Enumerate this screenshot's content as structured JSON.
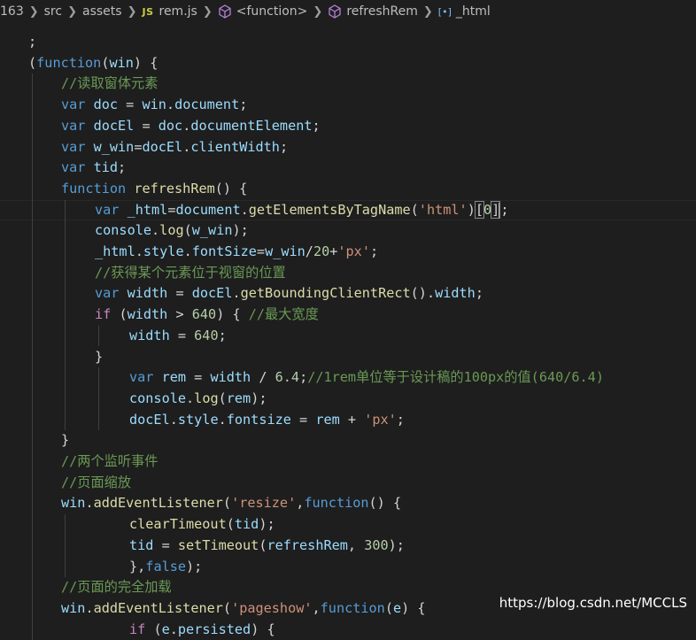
{
  "breadcrumb": {
    "line_ref": "163",
    "items": [
      "src",
      "assets",
      "rem.js",
      "<function>",
      "refreshRem",
      "_html"
    ],
    "js_badge": "JS"
  },
  "code": {
    "lines": [
      [
        [
          "pl",
          ";"
        ]
      ],
      [
        [
          "pl",
          "("
        ],
        [
          "kw",
          "function"
        ],
        [
          "pl",
          "("
        ],
        [
          "vr",
          "win"
        ],
        [
          "pl",
          ") {"
        ]
      ],
      [
        [
          "cm",
          "//读取窗体元素"
        ]
      ],
      [
        [
          "kw",
          "var"
        ],
        [
          "pl",
          " "
        ],
        [
          "vr",
          "doc"
        ],
        [
          "pl",
          " = "
        ],
        [
          "vr",
          "win"
        ],
        [
          "pl",
          "."
        ],
        [
          "vr",
          "document"
        ],
        [
          "pl",
          ";"
        ]
      ],
      [
        [
          "kw",
          "var"
        ],
        [
          "pl",
          " "
        ],
        [
          "vr",
          "docEl"
        ],
        [
          "pl",
          " = "
        ],
        [
          "vr",
          "doc"
        ],
        [
          "pl",
          "."
        ],
        [
          "vr",
          "documentElement"
        ],
        [
          "pl",
          ";"
        ]
      ],
      [
        [
          "kw",
          "var"
        ],
        [
          "pl",
          " "
        ],
        [
          "vr",
          "w_win"
        ],
        [
          "pl",
          "="
        ],
        [
          "vr",
          "docEl"
        ],
        [
          "pl",
          "."
        ],
        [
          "vr",
          "clientWidth"
        ],
        [
          "pl",
          ";"
        ]
      ],
      [
        [
          "kw",
          "var"
        ],
        [
          "pl",
          " "
        ],
        [
          "vr",
          "tid"
        ],
        [
          "pl",
          ";"
        ]
      ],
      [
        [
          "kw",
          "function"
        ],
        [
          "pl",
          " "
        ],
        [
          "fn",
          "refreshRem"
        ],
        [
          "pl",
          "() {"
        ]
      ],
      [
        [
          "kw",
          "var"
        ],
        [
          "pl",
          " "
        ],
        [
          "vr",
          "_html"
        ],
        [
          "pl",
          "="
        ],
        [
          "vr",
          "document"
        ],
        [
          "pl",
          "."
        ],
        [
          "fn",
          "getElementsByTagName"
        ],
        [
          "pl",
          "("
        ],
        [
          "str",
          "'html'"
        ],
        [
          "pl",
          ")"
        ],
        [
          "brk",
          "["
        ],
        [
          "num",
          "0"
        ],
        [
          "brk",
          "]"
        ],
        [
          "cursor",
          ""
        ],
        [
          "pl",
          ";"
        ]
      ],
      [
        [
          "vr",
          "console"
        ],
        [
          "pl",
          "."
        ],
        [
          "fn",
          "log"
        ],
        [
          "pl",
          "("
        ],
        [
          "vr",
          "w_win"
        ],
        [
          "pl",
          ");"
        ]
      ],
      [
        [
          "vr",
          "_html"
        ],
        [
          "pl",
          "."
        ],
        [
          "vr",
          "style"
        ],
        [
          "pl",
          "."
        ],
        [
          "vr",
          "fontSize"
        ],
        [
          "pl",
          "="
        ],
        [
          "vr",
          "w_win"
        ],
        [
          "pl",
          "/"
        ],
        [
          "num",
          "20"
        ],
        [
          "pl",
          "+"
        ],
        [
          "str",
          "'px'"
        ],
        [
          "pl",
          ";"
        ]
      ],
      [
        [
          "cm",
          "//获得某个元素位于视窗的位置"
        ]
      ],
      [
        [
          "kw",
          "var"
        ],
        [
          "pl",
          " "
        ],
        [
          "vr",
          "width"
        ],
        [
          "pl",
          " = "
        ],
        [
          "vr",
          "docEl"
        ],
        [
          "pl",
          "."
        ],
        [
          "fn",
          "getBoundingClientRect"
        ],
        [
          "pl",
          "()."
        ],
        [
          "vr",
          "width"
        ],
        [
          "pl",
          ";"
        ]
      ],
      [
        [
          "ctl",
          "if"
        ],
        [
          "pl",
          " ("
        ],
        [
          "vr",
          "width"
        ],
        [
          "pl",
          " > "
        ],
        [
          "num",
          "640"
        ],
        [
          "pl",
          ") { "
        ],
        [
          "cm",
          "//最大宽度"
        ]
      ],
      [
        [
          "vr",
          "width"
        ],
        [
          "pl",
          " = "
        ],
        [
          "num",
          "640"
        ],
        [
          "pl",
          ";"
        ]
      ],
      [
        [
          "pl",
          "}"
        ]
      ],
      [
        [
          "kw",
          "var"
        ],
        [
          "pl",
          " "
        ],
        [
          "vr",
          "rem"
        ],
        [
          "pl",
          " = "
        ],
        [
          "vr",
          "width"
        ],
        [
          "pl",
          " / "
        ],
        [
          "num",
          "6.4"
        ],
        [
          "pl",
          ";"
        ],
        [
          "cm",
          "//1rem单位等于设计稿的100px的值(640/6.4)"
        ]
      ],
      [
        [
          "vr",
          "console"
        ],
        [
          "pl",
          "."
        ],
        [
          "fn",
          "log"
        ],
        [
          "pl",
          "("
        ],
        [
          "vr",
          "rem"
        ],
        [
          "pl",
          ");"
        ]
      ],
      [
        [
          "vr",
          "docEl"
        ],
        [
          "pl",
          "."
        ],
        [
          "vr",
          "style"
        ],
        [
          "pl",
          "."
        ],
        [
          "vr",
          "fontsize"
        ],
        [
          "pl",
          " = "
        ],
        [
          "vr",
          "rem"
        ],
        [
          "pl",
          " + "
        ],
        [
          "str",
          "'px'"
        ],
        [
          "pl",
          ";"
        ]
      ],
      [
        [
          "pl",
          "}"
        ]
      ],
      [
        [
          "cm",
          "//两个监听事件"
        ]
      ],
      [
        [
          "cm",
          "//页面缩放"
        ]
      ],
      [
        [
          "vr",
          "win"
        ],
        [
          "pl",
          "."
        ],
        [
          "fn",
          "addEventListener"
        ],
        [
          "pl",
          "("
        ],
        [
          "str",
          "'resize'"
        ],
        [
          "pl",
          ","
        ],
        [
          "kw",
          "function"
        ],
        [
          "pl",
          "() {"
        ]
      ],
      [
        [
          "fn",
          "clearTimeout"
        ],
        [
          "pl",
          "("
        ],
        [
          "vr",
          "tid"
        ],
        [
          "pl",
          ");"
        ]
      ],
      [
        [
          "vr",
          "tid"
        ],
        [
          "pl",
          " = "
        ],
        [
          "fn",
          "setTimeout"
        ],
        [
          "pl",
          "("
        ],
        [
          "vr",
          "refreshRem"
        ],
        [
          "pl",
          ", "
        ],
        [
          "num",
          "300"
        ],
        [
          "pl",
          ");"
        ]
      ],
      [
        [
          "pl",
          "},"
        ],
        [
          "kw",
          "false"
        ],
        [
          "pl",
          ");"
        ]
      ],
      [
        [
          "cm",
          "//页面的完全加载"
        ]
      ],
      [
        [
          "vr",
          "win"
        ],
        [
          "pl",
          "."
        ],
        [
          "fn",
          "addEventListener"
        ],
        [
          "pl",
          "("
        ],
        [
          "str",
          "'pageshow'"
        ],
        [
          "pl",
          ","
        ],
        [
          "kw",
          "function"
        ],
        [
          "pl",
          "("
        ],
        [
          "vr",
          "e"
        ],
        [
          "pl",
          ") {"
        ]
      ],
      [
        [
          "ctl",
          "if"
        ],
        [
          "pl",
          " ("
        ],
        [
          "vr",
          "e"
        ],
        [
          "pl",
          "."
        ],
        [
          "vr",
          "persisted"
        ],
        [
          "pl",
          ") {"
        ]
      ]
    ]
  },
  "watermark": "https://blog.csdn.net/MCCLS"
}
